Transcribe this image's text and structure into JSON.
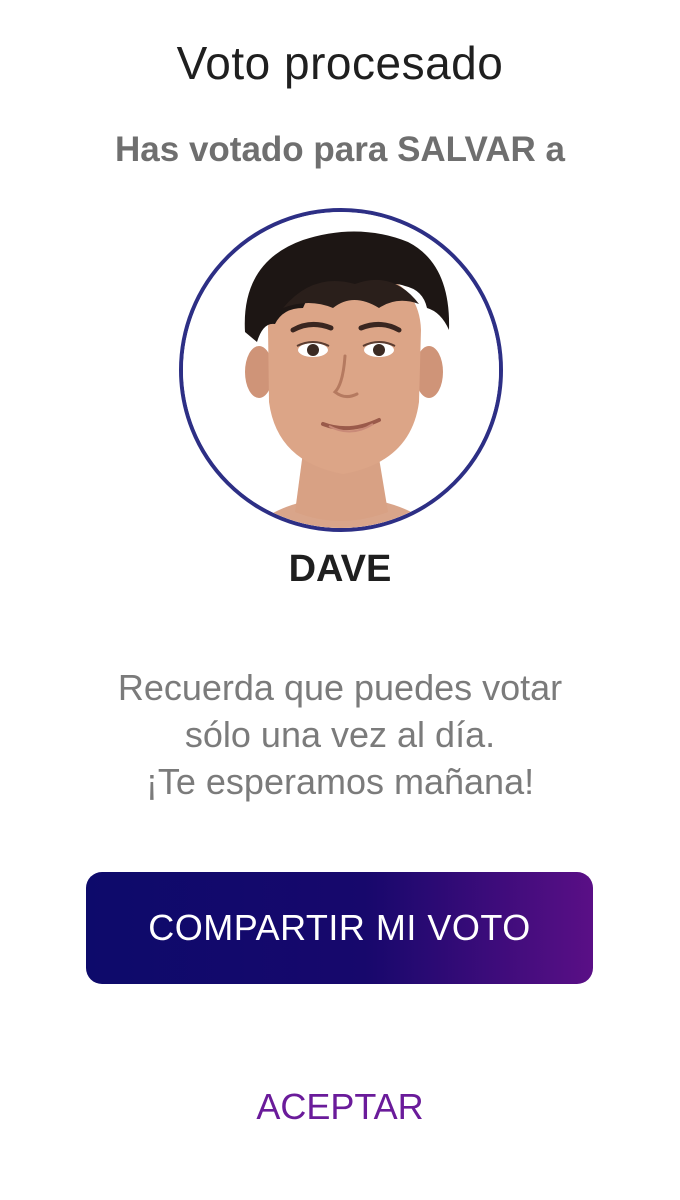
{
  "dialog": {
    "title": "Voto procesado",
    "subtitle": "Has votado para SALVAR a",
    "candidate": {
      "name": "DAVE",
      "photo": "candidate-photo"
    },
    "reminder_lines": [
      "Recuerda que puedes votar",
      "sólo una vez al día.",
      "¡Te esperamos mañana!"
    ],
    "share_button_label": "COMPARTIR MI VOTO",
    "accept_label": "ACEPTAR"
  },
  "colors": {
    "avatar_border": "#2d2f85",
    "button_gradient_start": "#0d0a6b",
    "button_gradient_end": "#5a0f86",
    "accept_link": "#6a1b9a"
  }
}
